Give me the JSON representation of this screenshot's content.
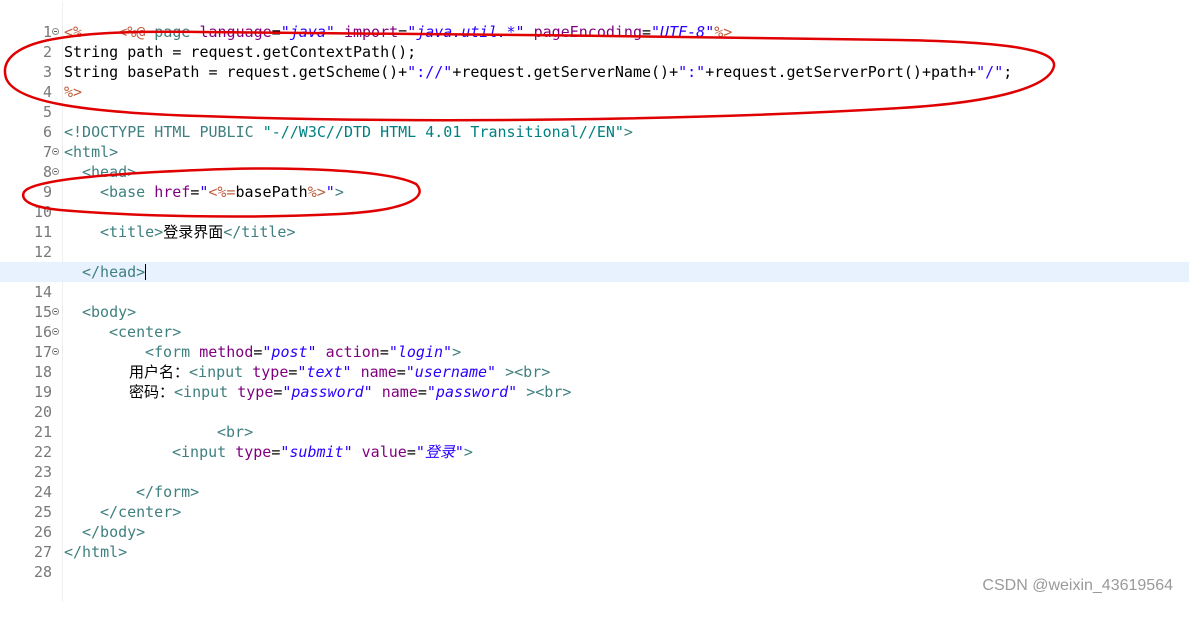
{
  "editor": {
    "lines": [
      {
        "n": "1",
        "fold": false
      },
      {
        "n": "2",
        "fold": true
      },
      {
        "n": "3",
        "fold": false
      },
      {
        "n": "4",
        "fold": false
      },
      {
        "n": "5",
        "fold": false
      },
      {
        "n": "6",
        "fold": false
      },
      {
        "n": "7",
        "fold": false
      },
      {
        "n": "8",
        "fold": true
      },
      {
        "n": "9",
        "fold": true
      },
      {
        "n": "10",
        "fold": false
      },
      {
        "n": "11",
        "fold": false
      },
      {
        "n": "12",
        "fold": false
      },
      {
        "n": "13",
        "fold": false
      },
      {
        "n": "14",
        "fold": false
      },
      {
        "n": "15",
        "fold": false
      },
      {
        "n": "16",
        "fold": true
      },
      {
        "n": "17",
        "fold": true
      },
      {
        "n": "18",
        "fold": true
      },
      {
        "n": "19",
        "fold": false
      },
      {
        "n": "20",
        "fold": false
      },
      {
        "n": "21",
        "fold": false
      },
      {
        "n": "22",
        "fold": false
      },
      {
        "n": "23",
        "fold": false
      },
      {
        "n": "24",
        "fold": false
      },
      {
        "n": "25",
        "fold": false
      },
      {
        "n": "26",
        "fold": false
      },
      {
        "n": "27",
        "fold": false
      },
      {
        "n": "28",
        "fold": false
      }
    ],
    "code": {
      "l1": {
        "d1": "<%@",
        "kw": " page ",
        "a1": "language",
        "e1": "=",
        "v1": "\"java\"",
        "a2": " import",
        "e2": "=",
        "v2": "\"java.util.*\"",
        "a3": " pageEncoding",
        "e3": "=",
        "v3": "\"UTF-8\"",
        "d2": "%>"
      },
      "l2": {
        "d1": "<%"
      },
      "l3": {
        "t": "String path = request.getContextPath();"
      },
      "l4": {
        "t1": "String basePath = request.getScheme()+",
        "s1": "\"://\"",
        "t2": "+request.getServerName()+",
        "s2": "\":\"",
        "t3": "+request.getServerPort()+path+",
        "s3": "\"/\"",
        "t4": ";"
      },
      "l5": {
        "d1": "%>"
      },
      "l7": {
        "t": "<!DOCTYPE HTML PUBLIC ",
        "s": "\"-//W3C//DTD HTML 4.01 Transitional//EN\"",
        "e": ">"
      },
      "l8": {
        "t": "<html>"
      },
      "l9": {
        "t": "<head>"
      },
      "l10": {
        "o": "<base ",
        "a": "href",
        "e": "=",
        "q1": "\"",
        "d1": "<%=",
        "p": "basePath",
        "d2": "%>",
        "q2": "\"",
        "c": ">"
      },
      "l12": {
        "o": "<title>",
        "p": "登录界面",
        "c": "</title>"
      },
      "l14": {
        "t": "</head>"
      },
      "l16": {
        "t": "<body>"
      },
      "l17": {
        "t": "<center>"
      },
      "l18": {
        "o": "<form ",
        "a1": "method",
        "e1": "=",
        "v1": "\"post\"",
        "a2": " action",
        "e2": "=",
        "v2": "\"login\"",
        "c": ">"
      },
      "l19": {
        "p": "用户名：",
        "o": "<input ",
        "a1": "type",
        "e1": "=",
        "v1": "\"text\"",
        "a2": " name",
        "e2": "=",
        "v2": "\"username\"",
        "c": " ><br>"
      },
      "l20": {
        "p": "密码：",
        "o": "<input ",
        "a1": "type",
        "e1": "=",
        "v1": "\"password\"",
        "a2": " name",
        "e2": "=",
        "v2": "\"password\"",
        "c": " ><br>"
      },
      "l22": {
        "t": "<br>"
      },
      "l23": {
        "o": "<input ",
        "a1": "type",
        "e1": "=",
        "v1": "\"submit\"",
        "a2": " value",
        "e2": "=",
        "v2": "\"登录\"",
        "c": ">"
      },
      "l25": {
        "t": "</form>"
      },
      "l26": {
        "t": "</center>"
      },
      "l27": {
        "t": "</body>"
      },
      "l28": {
        "t": "</html>"
      }
    }
  },
  "watermark": "CSDN @weixin_43619564",
  "colors": {
    "ink": "#e00000",
    "current_line": "#e8f2fe"
  }
}
